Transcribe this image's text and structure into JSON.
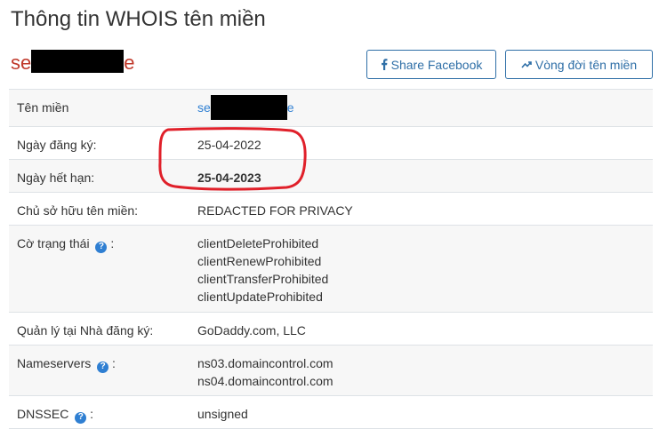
{
  "page": {
    "title": "Thông tin WHOIS tên miền",
    "domain_prefix": "se",
    "domain_suffix": "e"
  },
  "buttons": {
    "share_facebook": "Share Facebook",
    "lifecycle": "Vòng đời tên miền"
  },
  "rows": {
    "domain": {
      "label": "Tên miền",
      "value_prefix": "se",
      "value_suffix": "e"
    },
    "registered": {
      "label": "Ngày đăng ký:",
      "value": "25-04-2022"
    },
    "expiry": {
      "label": "Ngày hết hạn:",
      "value": "25-04-2023"
    },
    "owner": {
      "label": "Chủ sở hữu tên miền:",
      "value": "REDACTED FOR PRIVACY"
    },
    "status": {
      "label": "Cờ trạng thái",
      "label_suffix": ":",
      "values": [
        "clientDeleteProhibited",
        "clientRenewProhibited",
        "clientTransferProhibited",
        "clientUpdateProhibited"
      ]
    },
    "registrar": {
      "label": "Quản lý tại Nhà đăng ký:",
      "value": "GoDaddy.com, LLC"
    },
    "nameservers": {
      "label": "Nameservers",
      "label_suffix": ":",
      "values": [
        "ns03.domaincontrol.com",
        "ns04.domaincontrol.com"
      ]
    },
    "dnssec": {
      "label": "DNSSEC",
      "label_suffix": ":",
      "value": "unsigned"
    }
  },
  "colors": {
    "accent": "#2f6fa7",
    "domain_red": "#c0392b",
    "link": "#2f7fd2",
    "annotation": "#e0202a"
  },
  "icons": {
    "facebook": "facebook-icon",
    "trend": "trend-icon",
    "help": "question-circle-icon"
  }
}
